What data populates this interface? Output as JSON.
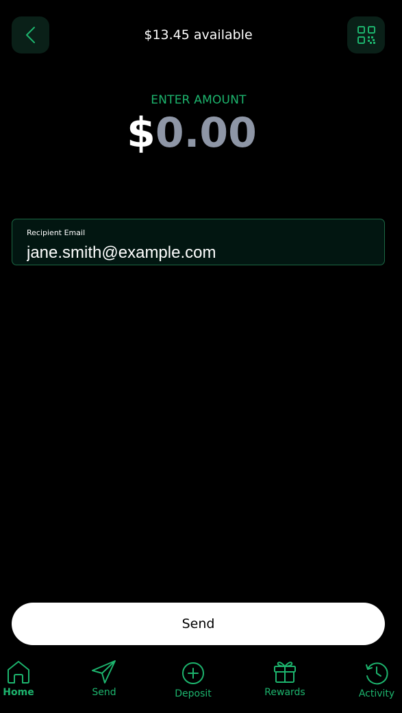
{
  "header": {
    "balance_text": "$13.45 available"
  },
  "amount": {
    "label": "ENTER AMOUNT",
    "currency_symbol": "$",
    "value": "0.00"
  },
  "recipient": {
    "label": "Recipient Email",
    "value": "jane.smith@example.com"
  },
  "send_button": {
    "label": "Send"
  },
  "nav": {
    "items": [
      {
        "label": "Home",
        "icon": "home-icon",
        "active": true
      },
      {
        "label": "Send",
        "icon": "paper-plane-icon",
        "active": false
      },
      {
        "label": "Deposit",
        "icon": "plus-circle-icon",
        "active": false
      },
      {
        "label": "Rewards",
        "icon": "gift-icon",
        "active": false
      },
      {
        "label": "Activity",
        "icon": "history-icon",
        "active": false
      }
    ]
  },
  "colors": {
    "accent": "#1db56e",
    "background": "#000000",
    "button_tile": "#0a2018",
    "field_border": "#1c6a45",
    "amount_muted": "#8e96a6"
  }
}
